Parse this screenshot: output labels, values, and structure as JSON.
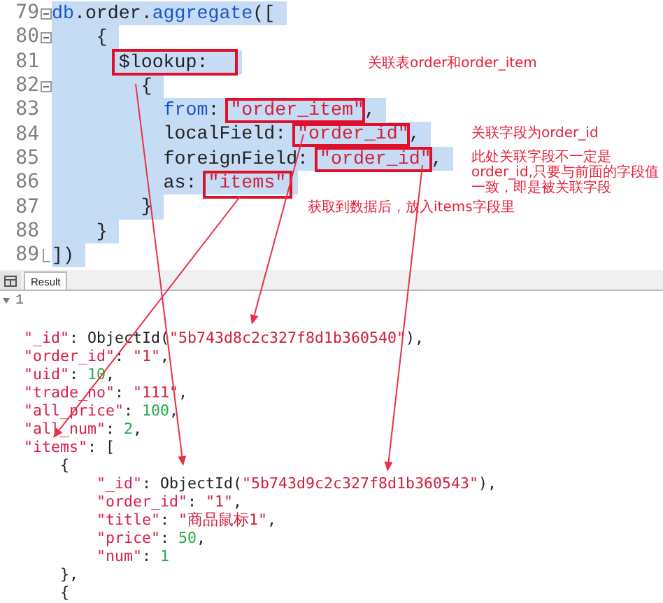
{
  "editor": {
    "lines": [
      {
        "number": "79",
        "kind": "fold-start",
        "tokens": [
          {
            "text": "db",
            "kind": "keyword"
          },
          {
            "text": ".order.",
            "kind": "plain"
          },
          {
            "text": "aggregate",
            "kind": "keyword"
          },
          {
            "text": "([",
            "kind": "plain"
          }
        ]
      },
      {
        "number": "80",
        "kind": "fold-start",
        "tokens": [
          {
            "text": "    {",
            "kind": "plain"
          }
        ]
      },
      {
        "number": "81",
        "kind": "plain",
        "tokens": [
          {
            "text": "      $lookup:  ",
            "kind": "plain"
          }
        ]
      },
      {
        "number": "82",
        "kind": "fold-start",
        "tokens": [
          {
            "text": "        {",
            "kind": "plain"
          }
        ]
      },
      {
        "number": "83",
        "kind": "plain",
        "tokens": [
          {
            "text": "          from",
            "kind": "keyword"
          },
          {
            "text": ": ",
            "kind": "plain"
          },
          {
            "text": "\"order_item\"",
            "kind": "string"
          },
          {
            "text": ",",
            "kind": "plain"
          }
        ]
      },
      {
        "number": "84",
        "kind": "plain",
        "tokens": [
          {
            "text": "          localField: ",
            "kind": "plain"
          },
          {
            "text": "\"order_id\"",
            "kind": "string"
          },
          {
            "text": ",",
            "kind": "plain"
          }
        ]
      },
      {
        "number": "85",
        "kind": "plain",
        "tokens": [
          {
            "text": "          foreignField: ",
            "kind": "plain"
          },
          {
            "text": "\"order_id\"",
            "kind": "string"
          },
          {
            "text": ",",
            "kind": "plain"
          }
        ]
      },
      {
        "number": "86",
        "kind": "plain",
        "tokens": [
          {
            "text": "          as: ",
            "kind": "plain"
          },
          {
            "text": "\"items\"",
            "kind": "string"
          }
        ]
      },
      {
        "number": "87",
        "kind": "plain",
        "tokens": [
          {
            "text": "        }",
            "kind": "plain"
          }
        ]
      },
      {
        "number": "88",
        "kind": "plain",
        "tokens": [
          {
            "text": "    }",
            "kind": "plain"
          }
        ]
      },
      {
        "number": "89",
        "kind": "fold-end",
        "tokens": [
          {
            "text": "])",
            "kind": "plain"
          }
        ]
      }
    ]
  },
  "notes": [
    "关联表order和order_item",
    "关联字段为order_id",
    "此处关联字段不一定是order_id,只要与前面的字段值一致，即是被关联字段",
    "获取到数据后，放入items字段里"
  ],
  "result_tabs": [
    {
      "label": "Result",
      "selected": true
    }
  ],
  "result_index": "1",
  "result_lines": [
    {
      "tokens": [
        {
          "text": "  \"_id\"",
          "kind": "key"
        },
        {
          "text": ": ObjectId(",
          "kind": "plain"
        },
        {
          "text": "\"5b743d8c2c327f8d1b360540\"",
          "kind": "string"
        },
        {
          "text": "),",
          "kind": "plain"
        }
      ]
    },
    {
      "tokens": [
        {
          "text": "  \"order_id\"",
          "kind": "key"
        },
        {
          "text": ": ",
          "kind": "plain"
        },
        {
          "text": "\"1\"",
          "kind": "string"
        },
        {
          "text": ",",
          "kind": "plain"
        }
      ]
    },
    {
      "tokens": [
        {
          "text": "  \"uid\"",
          "kind": "key"
        },
        {
          "text": ": ",
          "kind": "plain"
        },
        {
          "text": "10",
          "kind": "number"
        },
        {
          "text": ",",
          "kind": "plain"
        }
      ]
    },
    {
      "tokens": [
        {
          "text": "  \"trade_no\"",
          "kind": "key"
        },
        {
          "text": ": ",
          "kind": "plain"
        },
        {
          "text": "\"111\"",
          "kind": "string"
        },
        {
          "text": ",",
          "kind": "plain"
        }
      ]
    },
    {
      "tokens": [
        {
          "text": "  \"all_price\"",
          "kind": "key"
        },
        {
          "text": ": ",
          "kind": "plain"
        },
        {
          "text": "100",
          "kind": "number"
        },
        {
          "text": ",",
          "kind": "plain"
        }
      ]
    },
    {
      "tokens": [
        {
          "text": "  \"all_num\"",
          "kind": "key"
        },
        {
          "text": ": ",
          "kind": "plain"
        },
        {
          "text": "2",
          "kind": "number"
        },
        {
          "text": ",",
          "kind": "plain"
        }
      ]
    },
    {
      "tokens": [
        {
          "text": "  \"items\"",
          "kind": "key"
        },
        {
          "text": ": [",
          "kind": "plain"
        }
      ]
    },
    {
      "tokens": [
        {
          "text": "      {",
          "kind": "plain"
        }
      ]
    },
    {
      "tokens": [
        {
          "text": "          \"_id\"",
          "kind": "key"
        },
        {
          "text": ": ObjectId(",
          "kind": "plain"
        },
        {
          "text": "\"5b743d9c2c327f8d1b360543\"",
          "kind": "string"
        },
        {
          "text": "),",
          "kind": "plain"
        }
      ]
    },
    {
      "tokens": [
        {
          "text": "          \"order_id\"",
          "kind": "key"
        },
        {
          "text": ": ",
          "kind": "plain"
        },
        {
          "text": "\"1\"",
          "kind": "string"
        },
        {
          "text": ",",
          "kind": "plain"
        }
      ]
    },
    {
      "tokens": [
        {
          "text": "          \"title\"",
          "kind": "key"
        },
        {
          "text": ": ",
          "kind": "plain"
        },
        {
          "text": "\"商品鼠标1\"",
          "kind": "string"
        },
        {
          "text": ",",
          "kind": "plain"
        }
      ]
    },
    {
      "tokens": [
        {
          "text": "          \"price\"",
          "kind": "key"
        },
        {
          "text": ": ",
          "kind": "plain"
        },
        {
          "text": "50",
          "kind": "number"
        },
        {
          "text": ",",
          "kind": "plain"
        }
      ]
    },
    {
      "tokens": [
        {
          "text": "          \"num\"",
          "kind": "key"
        },
        {
          "text": ": ",
          "kind": "plain"
        },
        {
          "text": "1",
          "kind": "number"
        }
      ]
    },
    {
      "tokens": [
        {
          "text": "      },",
          "kind": "plain"
        }
      ]
    },
    {
      "tokens": [
        {
          "text": "      {",
          "kind": "plain"
        }
      ]
    }
  ]
}
